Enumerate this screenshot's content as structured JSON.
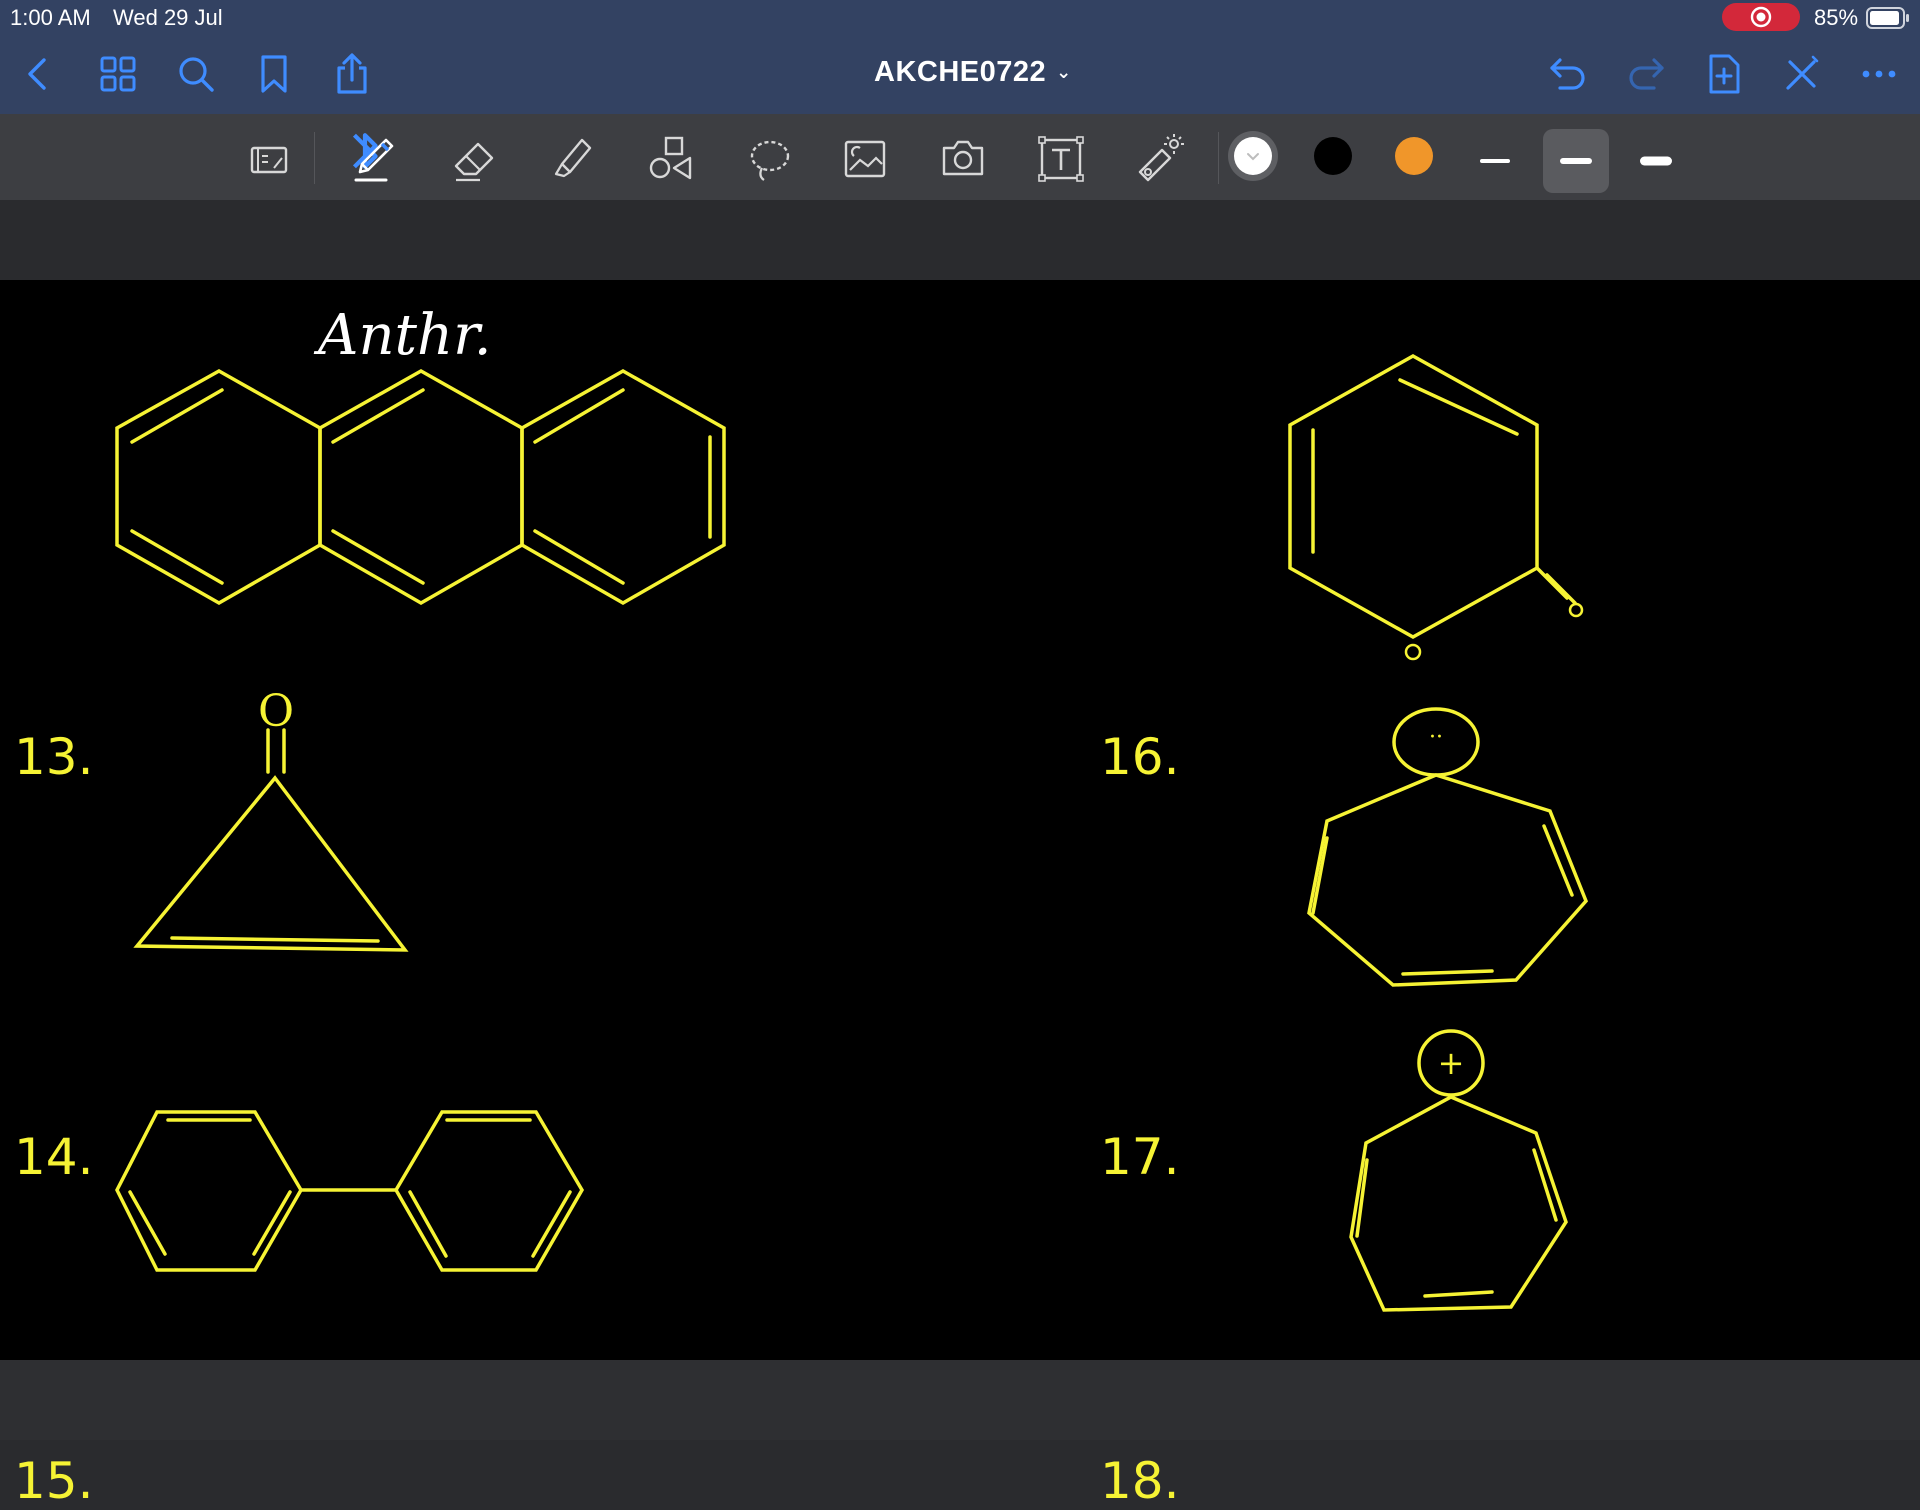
{
  "status": {
    "time": "1:00 AM",
    "date": "Wed 29 Jul",
    "battery": "85%"
  },
  "nav": {
    "title": "AKCHE0722",
    "icons": [
      "back-chevron-icon",
      "grid-icon",
      "search-icon",
      "bookmark-icon",
      "share-icon",
      "undo-icon",
      "redo-icon",
      "add-page-icon",
      "close-pen-icon",
      "more-icon"
    ]
  },
  "toolbar": {
    "tools": [
      "reader-mode",
      "pen",
      "eraser",
      "highlighter",
      "shapes",
      "lasso",
      "image",
      "camera",
      "text",
      "laser-pointer"
    ],
    "active_tool": "pen",
    "colors": [
      "#ffffff",
      "#000000",
      "#f0962a"
    ],
    "active_color": "#ffffff",
    "thickness_options": 3,
    "active_thickness": 2
  },
  "page": {
    "ink_color": "#f6f334",
    "handwritten_note": "Anthr.",
    "questions": [
      {
        "number": "13.",
        "structure": "anthracene"
      },
      {
        "number": "14.",
        "structure": "cyclopropenone"
      },
      {
        "number": "15.",
        "structure": "biphenyl"
      },
      {
        "number": "16.",
        "structure": "pyranone"
      },
      {
        "number": "17.",
        "structure": "cycloheptatrienyl-anion"
      },
      {
        "number": "18.",
        "structure": "tropylium-cation"
      }
    ],
    "atom_labels": {
      "carbonyl_oxygen": "O",
      "ring_oxygen": "O",
      "anion_charge": "··",
      "cation_charge": "+"
    }
  }
}
